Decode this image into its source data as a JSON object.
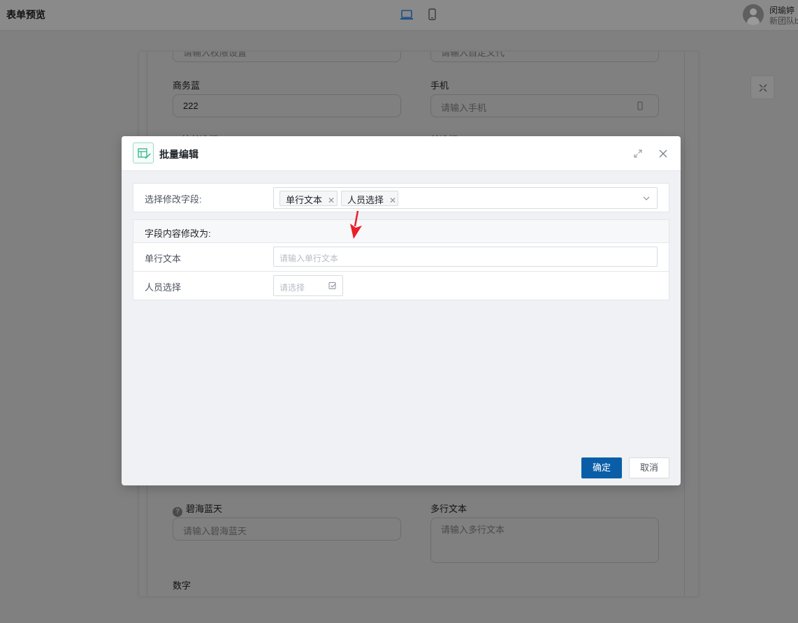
{
  "header": {
    "title": "表单预览",
    "user_name": "闵瑜婷",
    "user_team": "新团队b"
  },
  "background_form": {
    "top_left_placeholder": "请输入权限设置",
    "top_right_placeholder": "请输入自定义代",
    "field1_label": "商务蓝",
    "field1_value": "222",
    "field2_label": "手机",
    "field2_placeholder": "请输入手机",
    "field3_label": "下拉单选框",
    "field4_label": "单选框",
    "field5_label": "碧海蓝天",
    "field5_placeholder": "请输入碧海蓝天",
    "field6_label": "多行文本",
    "field6_placeholder": "请输入多行文本",
    "field7_label": "数字"
  },
  "modal": {
    "title": "批量编辑",
    "select_label": "选择修改字段:",
    "selected_tags": [
      "单行文本",
      "人员选择"
    ],
    "edit_heading": "字段内容修改为:",
    "rows": [
      {
        "label": "单行文本",
        "placeholder": "请输入单行文本"
      },
      {
        "label": "人员选择",
        "placeholder": "请选择"
      }
    ],
    "ok_label": "确定",
    "cancel_label": "取消"
  },
  "colors": {
    "primary": "#0a5ea8",
    "overlay": "#808080",
    "annotation_arrow": "#e8202a"
  }
}
